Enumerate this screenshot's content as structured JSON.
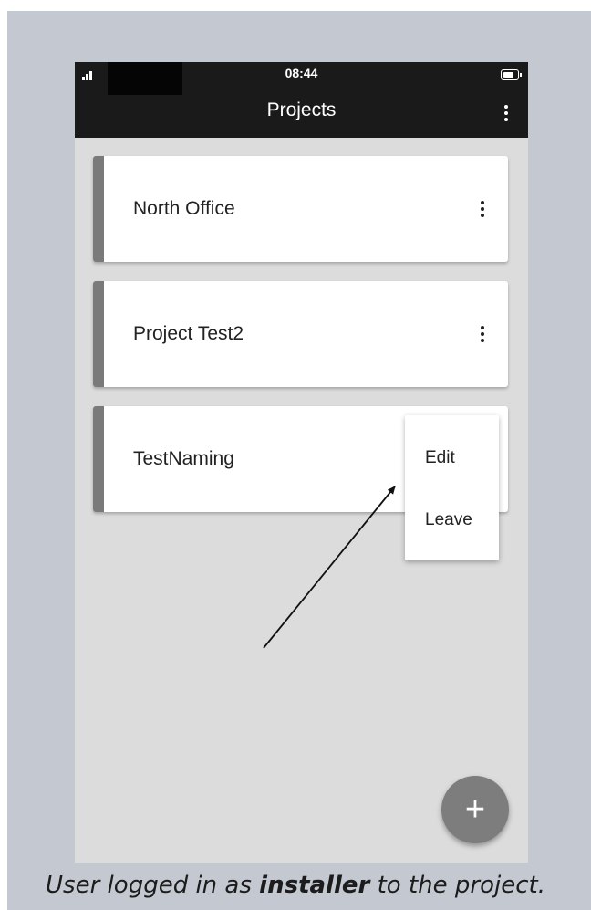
{
  "status_bar": {
    "time": "08:44",
    "icons": [
      "signal-icon",
      "battery-icon"
    ]
  },
  "app_bar": {
    "title": "Projects",
    "menu_icon": "more-vert-icon"
  },
  "projects": [
    {
      "name": "North Office",
      "menu_icon": "more-vert-icon"
    },
    {
      "name": "Project Test2",
      "menu_icon": "more-vert-icon"
    },
    {
      "name": "TestNaming"
    }
  ],
  "context_menu": {
    "items": [
      "Edit",
      "Leave"
    ]
  },
  "fab": {
    "label": "+",
    "icon": "add-icon"
  },
  "caption": {
    "before": "User logged in as ",
    "emphasis": "installer",
    "after": " to the project."
  },
  "colors": {
    "background": "#c4c8d0",
    "app_bar": "#1a1a1a",
    "screen": "#dcdcdc",
    "card_stripe": "#7a7a7a",
    "fab": "#7d7d7d"
  }
}
